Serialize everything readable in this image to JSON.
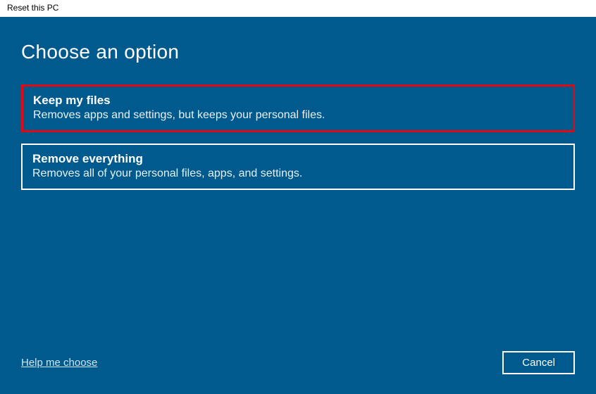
{
  "window": {
    "title": "Reset this PC"
  },
  "dialog": {
    "heading": "Choose an option",
    "options": [
      {
        "title": "Keep my files",
        "desc": "Removes apps and settings, but keeps your personal files."
      },
      {
        "title": "Remove everything",
        "desc": "Removes all of your personal files, apps, and settings."
      }
    ],
    "help_link": "Help me choose",
    "cancel": "Cancel"
  }
}
